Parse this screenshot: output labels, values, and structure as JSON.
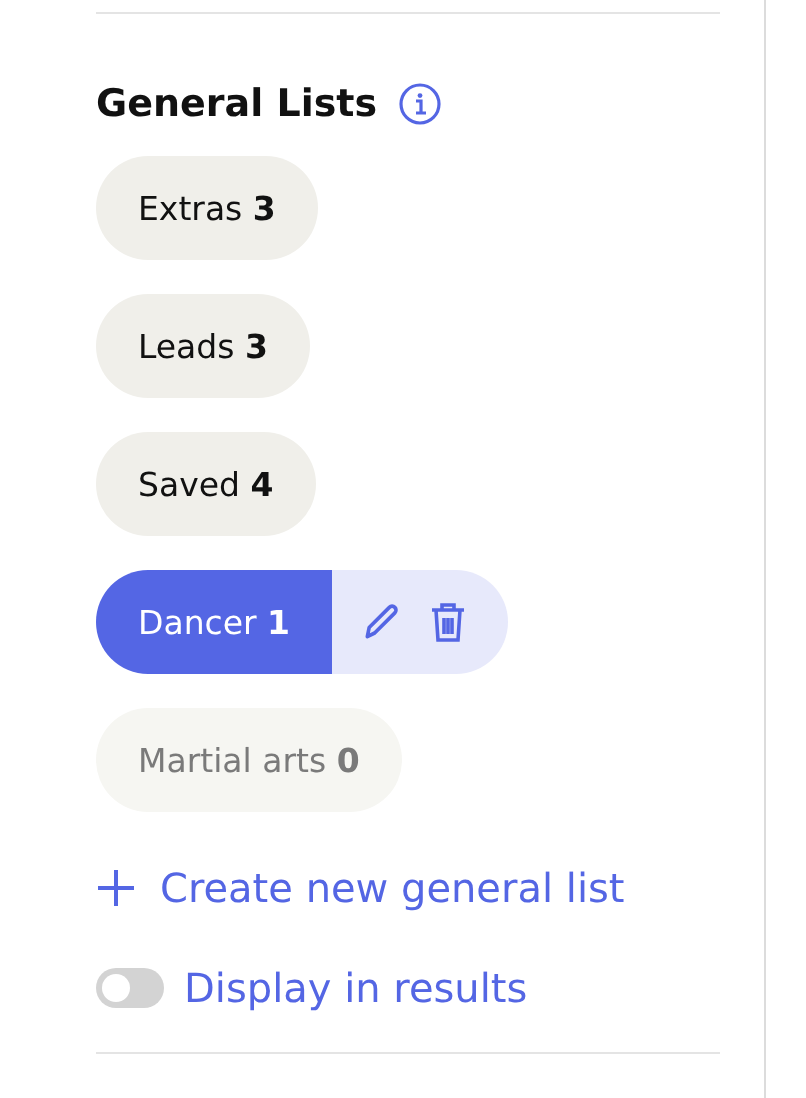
{
  "section": {
    "title": "General Lists"
  },
  "lists": [
    {
      "name": "Extras",
      "count": "3",
      "selected": false,
      "disabled": false
    },
    {
      "name": "Leads",
      "count": "3",
      "selected": false,
      "disabled": false
    },
    {
      "name": "Saved",
      "count": "4",
      "selected": false,
      "disabled": false
    },
    {
      "name": "Dancer",
      "count": "1",
      "selected": true,
      "disabled": false
    },
    {
      "name": "Martial arts",
      "count": "0",
      "selected": false,
      "disabled": true
    }
  ],
  "create_link": {
    "label": "Create new general list"
  },
  "display_toggle": {
    "label": "Display in results",
    "on": false
  }
}
